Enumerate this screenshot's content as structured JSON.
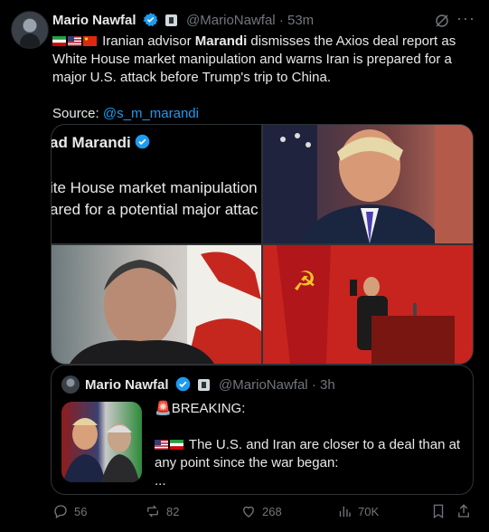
{
  "post": {
    "author_name": "Mario Nawfal",
    "handle": "@MarioNawfal",
    "separator": "·",
    "time": "53m",
    "more": "···",
    "text_pre": "Iranian advisor ",
    "text_bold": "Marandi",
    "text_post": " dismisses the Axios deal report as White House market manipulation and warns Iran is prepared for a major U.S. attack before Trump's trip to China.",
    "source_label": "Source: ",
    "source_link": "@s_m_marandi",
    "flags": [
      "iran-flag",
      "us-flag",
      "china-flag"
    ]
  },
  "media": {
    "tile1_name": "ad Marandi",
    "tile1_line1": "ite House market manipulation",
    "tile1_line2": "ared for a potential major attac"
  },
  "quote": {
    "author_name": "Mario Nawfal",
    "handle": "@MarioNawfal",
    "separator": "·",
    "time": "3h",
    "line1": "BREAKING:",
    "line2": "The U.S. and Iran are closer to a deal than at any point since the war began:",
    "line3": "..."
  },
  "actions": {
    "replies": "56",
    "reposts": "82",
    "likes": "268",
    "views": "70K"
  },
  "colors": {
    "accent": "#1d9bf0",
    "muted": "#71767b",
    "border": "#2f3336"
  }
}
